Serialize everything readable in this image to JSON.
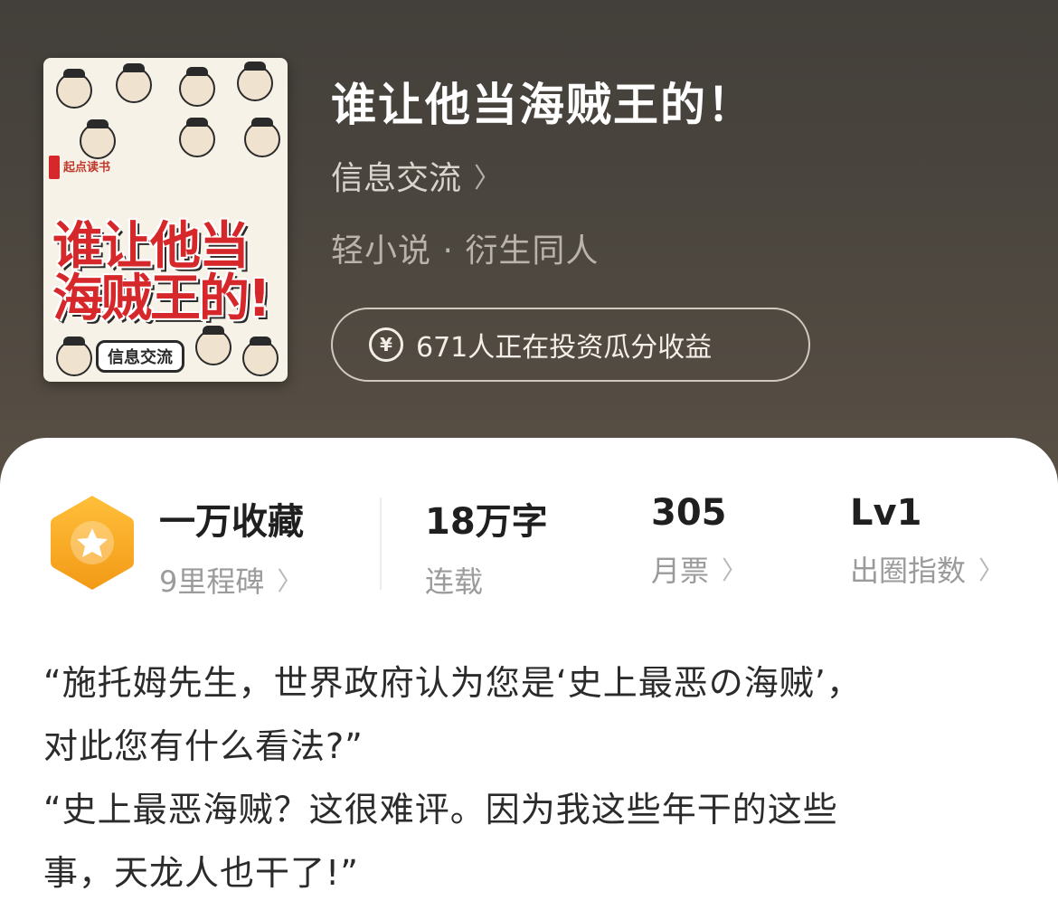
{
  "book": {
    "title": "谁让他当海贼王的！",
    "author": "信息交流",
    "genre": "轻小说 · 衍生同人",
    "invest_text": "671人正在投资瓜分收益",
    "cover": {
      "brand": "起点读书",
      "title_line1": "谁让他当",
      "title_line2": "海贼王的!",
      "author_badge": "信息交流"
    }
  },
  "stats": [
    {
      "value": "一万收藏",
      "label": "9里程碑"
    },
    {
      "value": "18万字",
      "label": "连载"
    },
    {
      "value": "305",
      "label": "月票"
    },
    {
      "value": "Lv1",
      "label": "出圈指数"
    }
  ],
  "description": [
    "“施托姆先生，世界政府认为您是‘史上最恶の海贼’，",
    "对此您有什么看法?”",
    "“史上最恶海贼？这很难评。因为我这些年干的这些",
    "事，天龙人也干了!”"
  ],
  "colors": {
    "accent": "#f5a623",
    "hero_bg": "#4a453e"
  }
}
